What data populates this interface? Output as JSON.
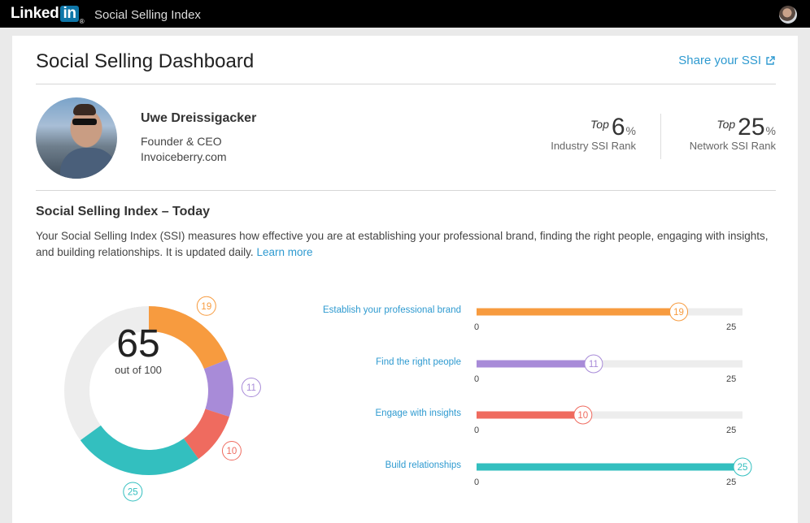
{
  "header": {
    "logo_text": "Linked",
    "logo_in": "in",
    "logo_reg": "®",
    "app_title": "Social Selling Index"
  },
  "dashboard": {
    "title": "Social Selling Dashboard",
    "share_label": "Share your SSI"
  },
  "profile": {
    "name": "Uwe Dreissigacker",
    "role": "Founder & CEO",
    "company": "Invoiceberry.com"
  },
  "ranks": [
    {
      "prefix": "Top",
      "value": "6",
      "unit": "%",
      "label": "Industry SSI Rank"
    },
    {
      "prefix": "Top",
      "value": "25",
      "unit": "%",
      "label": "Network SSI Rank"
    }
  ],
  "ssi": {
    "title": "Social Selling Index – Today",
    "description": "Your Social Selling Index (SSI) measures how effective you are at establishing your professional brand, finding the right people, engaging with insights, and building relationships. It is updated daily.",
    "learn_more": "Learn more",
    "score": "65",
    "score_caption": "out of 100"
  },
  "colors": {
    "accent": "#2e9ad0",
    "brand": "#f79b3f",
    "people": "#a88bd8",
    "insights": "#ef6b5f",
    "relationships": "#33bfbf",
    "track": "#ededed"
  },
  "chart_data": {
    "type": "bar",
    "categories": [
      "Establish your professional brand",
      "Find the right people",
      "Engage with insights",
      "Build relationships"
    ],
    "values": [
      19,
      11,
      10,
      25
    ],
    "xlim": [
      0,
      25
    ],
    "axis_min_label": "0",
    "axis_max_label": "25",
    "total": 65,
    "total_max": 100
  }
}
